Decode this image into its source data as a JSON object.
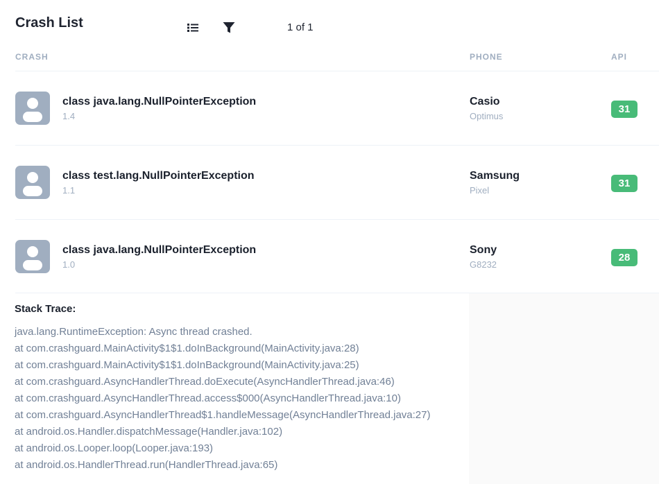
{
  "header": {
    "title": "Crash List",
    "list_icon": "list-icon",
    "filter_icon": "filter-icon",
    "pagination": "1 of 1"
  },
  "columns": {
    "crash": "CRASH",
    "phone": "PHONE",
    "api": "API"
  },
  "crashes": [
    {
      "exception": "class java.lang.NullPointerException",
      "version": "1.4",
      "brand": "Casio",
      "model": "Optimus",
      "api": "31",
      "avatar_icon": "user-avatar-icon"
    },
    {
      "exception": "class test.lang.NullPointerException",
      "version": "1.1",
      "brand": "Samsung",
      "model": "Pixel",
      "api": "31",
      "avatar_icon": "user-avatar-icon"
    },
    {
      "exception": "class java.lang.NullPointerException",
      "version": "1.0",
      "brand": "Sony",
      "model": "G8232",
      "api": "28",
      "avatar_icon": "user-avatar-icon"
    }
  ],
  "stack_trace": {
    "title": "Stack Trace:",
    "lines": [
      "java.lang.RuntimeException: Async thread crashed.",
      "at com.crashguard.MainActivity$1$1.doInBackground(MainActivity.java:28)",
      "at com.crashguard.MainActivity$1$1.doInBackground(MainActivity.java:25)",
      "at com.crashguard.AsyncHandlerThread.doExecute(AsyncHandlerThread.java:46)",
      "at com.crashguard.AsyncHandlerThread.access$000(AsyncHandlerThread.java:10)",
      "at com.crashguard.AsyncHandlerThread$1.handleMessage(AsyncHandlerThread.java:27)",
      "at android.os.Handler.dispatchMessage(Handler.java:102)",
      "at android.os.Looper.loop(Looper.java:193)",
      "at android.os.HandlerThread.run(HandlerThread.java:65)"
    ]
  },
  "colors": {
    "api_badge": "#48bb78",
    "avatar": "#a0aec0",
    "muted_text": "#a0aec0",
    "trace_text": "#718096"
  }
}
